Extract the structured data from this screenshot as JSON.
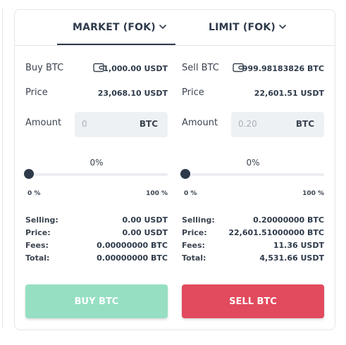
{
  "colors": {
    "buy_button": "#96dfc2",
    "sell_button": "#e24a5d",
    "text_dark": "#2e3a4a"
  },
  "tabs": [
    {
      "label": "MARKET (FOK)",
      "active": true,
      "icon": "chevron-down-icon"
    },
    {
      "label": "LIMIT (FOK)",
      "active": false,
      "icon": "chevron-down-icon"
    }
  ],
  "buy": {
    "title": "Buy BTC",
    "balance": "1,000.00 USDT",
    "price_label": "Price",
    "price": "23,068.10 USDT",
    "amount_label": "Amount",
    "amount_placeholder": "0",
    "amount_unit": "BTC",
    "percent": "0%",
    "slider_value": 0,
    "slider_min": "0 %",
    "slider_max": "100 %",
    "summary": [
      {
        "label": "Selling:",
        "value": "0.00 USDT"
      },
      {
        "label": "Price:",
        "value": "0.00 USDT"
      },
      {
        "label": "Fees:",
        "value": "0.00000000 BTC"
      },
      {
        "label": "Total:",
        "value": "0.00000000 BTC"
      }
    ],
    "button_label": "BUY BTC",
    "button_disabled": true
  },
  "sell": {
    "title": "Sell BTC",
    "balance": "999.98183826 BTC",
    "price_label": "Price",
    "price": "22,601.51 USDT",
    "amount_label": "Amount",
    "amount_placeholder": "0.20",
    "amount_unit": "BTC",
    "percent": "0%",
    "slider_value": 0,
    "slider_min": "0 %",
    "slider_max": "100 %",
    "summary": [
      {
        "label": "Selling:",
        "value": "0.20000000 BTC"
      },
      {
        "label": "Price:",
        "value": "22,601.51000000 BTC"
      },
      {
        "label": "Fees:",
        "value": "11.36 USDT"
      },
      {
        "label": "Total:",
        "value": "4,531.66 USDT"
      }
    ],
    "button_label": "SELL BTC",
    "button_disabled": false
  }
}
